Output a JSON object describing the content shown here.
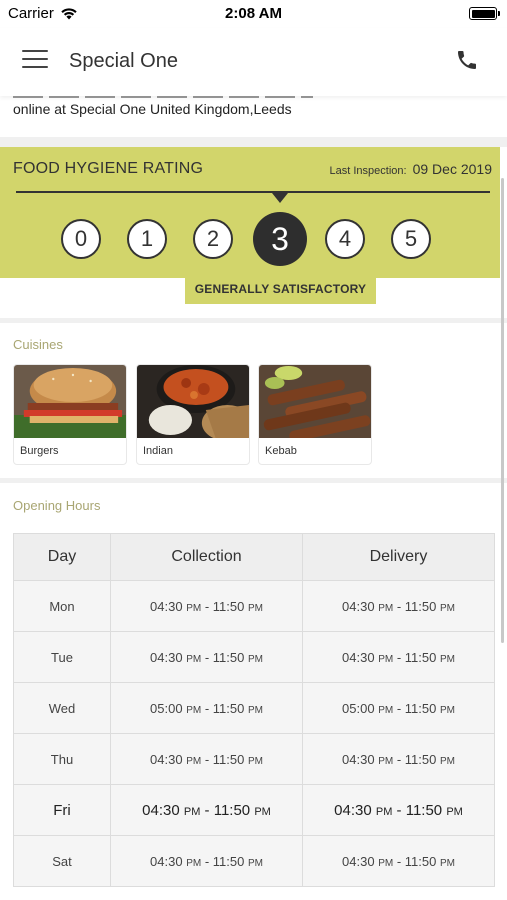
{
  "status_bar": {
    "carrier": "Carrier",
    "time": "2:08 AM"
  },
  "header": {
    "title": "Special One",
    "menu_icon": "hamburger-icon",
    "phone_icon": "phone-icon"
  },
  "about": {
    "text": "online at Special One United Kingdom,Leeds"
  },
  "hygiene": {
    "title": "FOOD HYGIENE RATING",
    "last_inspection_label": "Last Inspection:",
    "last_inspection_date": "09 Dec 2019",
    "ratings": [
      "0",
      "1",
      "2",
      "3",
      "4",
      "5"
    ],
    "selected_rating": 3,
    "verdict": "GENERALLY SATISFACTORY",
    "colors": {
      "band": "#d2d56b",
      "active": "#2e2e2e"
    }
  },
  "cuisines": {
    "label": "Cuisines",
    "items": [
      {
        "name": "Burgers",
        "image": "burger-photo"
      },
      {
        "name": "Indian",
        "image": "curry-photo"
      },
      {
        "name": "Kebab",
        "image": "kebab-photo"
      }
    ]
  },
  "opening_hours": {
    "label": "Opening Hours",
    "columns": [
      "Day",
      "Collection",
      "Delivery"
    ],
    "rows": [
      {
        "day": "Mon",
        "col_start": "04:30",
        "col_end": "11:50",
        "del_start": "04:30",
        "del_end": "11:50",
        "today": false
      },
      {
        "day": "Tue",
        "col_start": "04:30",
        "col_end": "11:50",
        "del_start": "04:30",
        "del_end": "11:50",
        "today": false
      },
      {
        "day": "Wed",
        "col_start": "05:00",
        "col_end": "11:50",
        "del_start": "05:00",
        "del_end": "11:50",
        "today": false
      },
      {
        "day": "Thu",
        "col_start": "04:30",
        "col_end": "11:50",
        "del_start": "04:30",
        "del_end": "11:50",
        "today": false
      },
      {
        "day": "Fri",
        "col_start": "04:30",
        "col_end": "11:50",
        "del_start": "04:30",
        "del_end": "11:50",
        "today": true
      },
      {
        "day": "Sat",
        "col_start": "04:30",
        "col_end": "11:50",
        "del_start": "04:30",
        "del_end": "11:50",
        "today": false
      }
    ],
    "suffix": "PM",
    "separator": " - "
  }
}
